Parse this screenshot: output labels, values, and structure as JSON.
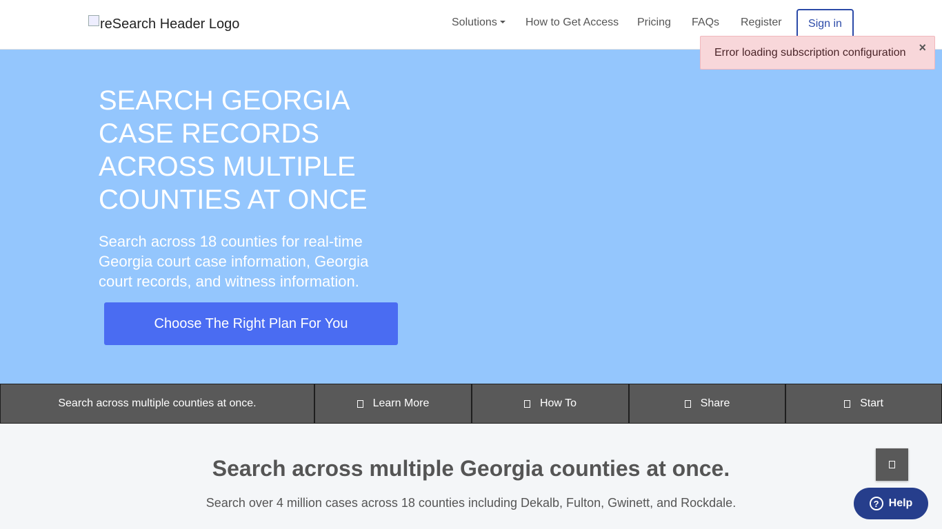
{
  "header": {
    "logo_alt": "reSearch Header Logo",
    "nav": {
      "solutions": "Solutions",
      "how_to_get_access": "How to Get Access",
      "pricing": "Pricing",
      "faqs": "FAQs",
      "register": "Register",
      "sign_in": "Sign in"
    }
  },
  "toast": {
    "message": "Error loading subscription configuration",
    "close": "×"
  },
  "hero": {
    "title": "SEARCH GEORGIA CASE RECORDS ACROSS MULTIPLE COUNTIES AT ONCE",
    "subtitle": "Search across 18 counties for real-time Georgia court case information, Georgia court records, and witness information.",
    "cta": "Choose The Right Plan For You"
  },
  "actionbar": {
    "tagline": "Search across multiple counties at once.",
    "learn_more": "Learn More",
    "how_to": "How To",
    "share": "Share",
    "start": "Start"
  },
  "section": {
    "title": "Search across multiple Georgia counties at once.",
    "subtitle": "Search over 4 million cases across 18 counties including Dekalb, Fulton, Gwinett, and Rockdale."
  },
  "help": {
    "label": "Help",
    "icon_glyph": "?"
  },
  "colors": {
    "hero_bg": "#94c6fd",
    "cta_bg": "#4a6cf2",
    "actionbar_bg": "#595959",
    "toast_bg": "#f8d7da",
    "signin_border": "#2b4aa8",
    "help_bg": "#263e8c"
  }
}
